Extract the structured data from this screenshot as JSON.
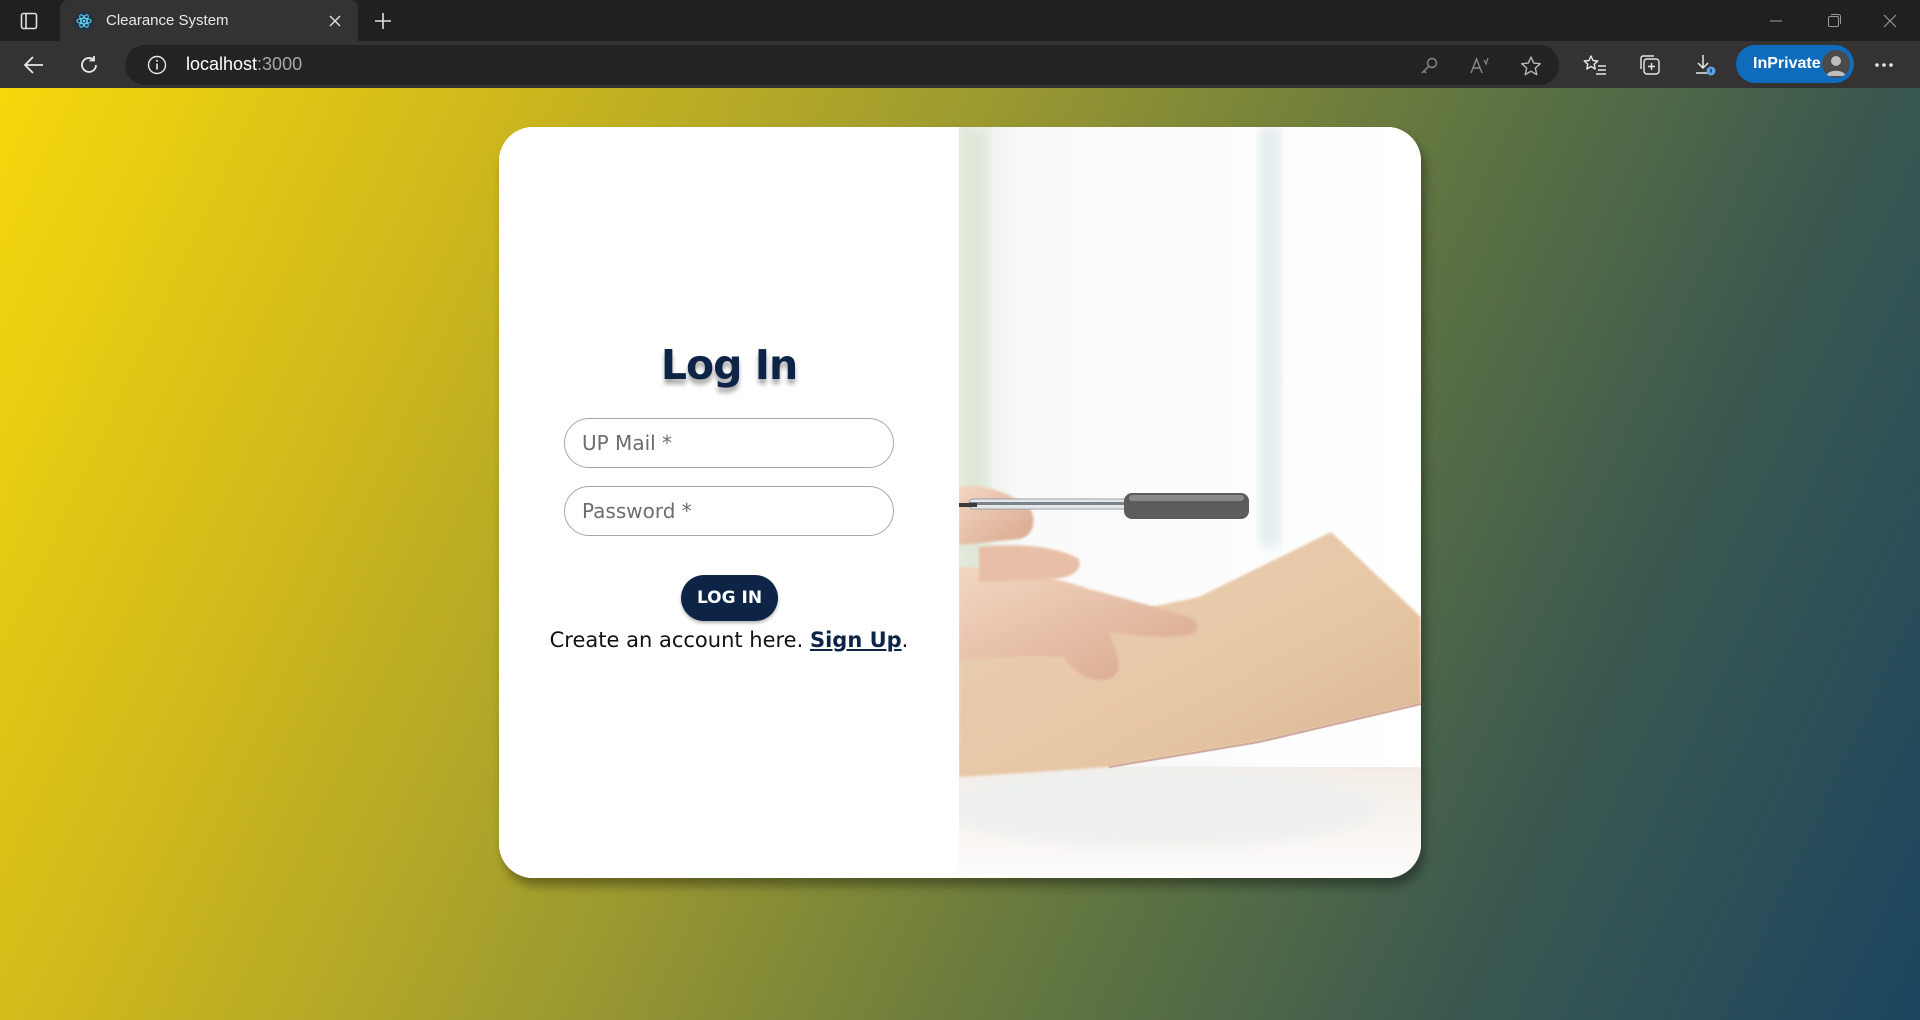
{
  "browser": {
    "tab_title": "Clearance System",
    "url_host": "localhost",
    "url_port": ":3000",
    "inprivate_label": "InPrivate"
  },
  "login": {
    "title": "Log In",
    "email_placeholder": "UP Mail *",
    "password_placeholder": "Password *",
    "login_button": "LOG IN",
    "signup_prefix": "Create an account here. ",
    "signup_link": "Sign Up",
    "signup_suffix": "."
  },
  "colors": {
    "primary": "#0d2447",
    "gradient_start": "#f6d80c",
    "gradient_end": "#1c4560",
    "inprivate": "#0f6cbd"
  },
  "icons": [
    "tab-actions-icon",
    "react-favicon-icon",
    "close-icon",
    "plus-icon",
    "minimize-icon",
    "restore-icon",
    "window-close-icon",
    "back-icon",
    "refresh-icon",
    "info-icon",
    "key-icon",
    "read-aloud-icon",
    "star-icon",
    "favorites-icon",
    "collections-icon",
    "download-icon",
    "more-icon"
  ]
}
